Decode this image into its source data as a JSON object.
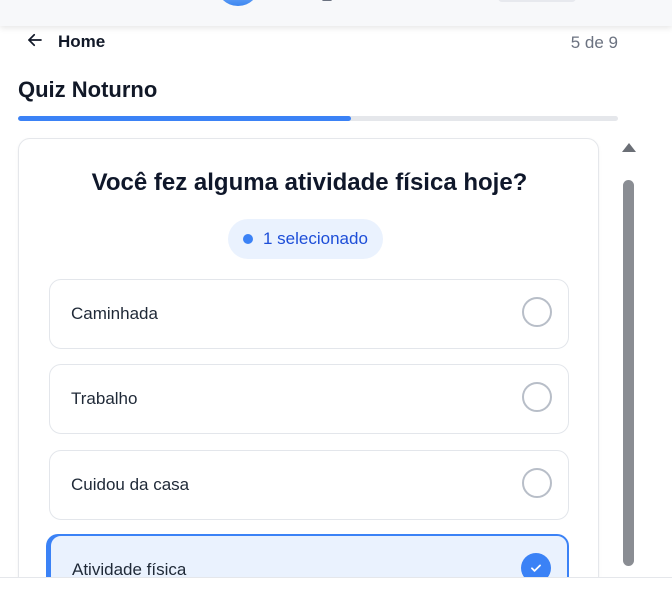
{
  "header": {
    "back_label": "Home",
    "step_counter": "5 de 9"
  },
  "quiz": {
    "title": "Quiz Noturno",
    "progress_fraction": 0.555
  },
  "question": {
    "text": "Você fez alguma atividade física hoje?",
    "selected_badge": "1 selecionado"
  },
  "options": [
    {
      "label": "Caminhada",
      "selected": false
    },
    {
      "label": "Trabalho",
      "selected": false
    },
    {
      "label": "Cuidou da casa",
      "selected": false
    },
    {
      "label": "Atividade física",
      "selected": true
    }
  ],
  "colors": {
    "accent": "#3b82f6",
    "selected_bg": "#eaf2fe",
    "badge_text": "#1d4ed8"
  },
  "icons": {
    "back": "arrow-left-icon",
    "check": "check-icon"
  }
}
